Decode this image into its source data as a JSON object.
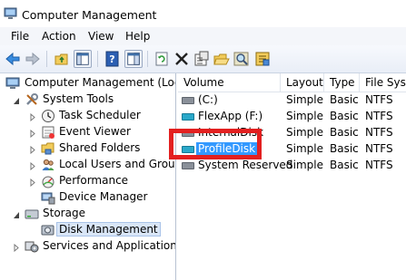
{
  "window": {
    "title": "Computer Management"
  },
  "menu": [
    "File",
    "Action",
    "View",
    "Help"
  ],
  "toolbar": {
    "buttons": [
      "back-icon",
      "forward-icon",
      "up-folder-icon",
      "show-hide-tree-icon",
      "help-icon",
      "properties-pane-icon",
      "refresh-icon",
      "delete-icon",
      "properties-icon",
      "open-icon",
      "search-icon",
      "settings-icon"
    ]
  },
  "tree": {
    "root": "Computer Management (Local",
    "items": [
      {
        "label": "System Tools",
        "icon": "tools-icon"
      },
      {
        "label": "Task Scheduler",
        "icon": "clock-icon"
      },
      {
        "label": "Event Viewer",
        "icon": "event-viewer-icon"
      },
      {
        "label": "Shared Folders",
        "icon": "shared-folder-icon"
      },
      {
        "label": "Local Users and Groups",
        "icon": "users-icon"
      },
      {
        "label": "Performance",
        "icon": "performance-icon"
      },
      {
        "label": "Device Manager",
        "icon": "device-manager-icon"
      },
      {
        "label": "Storage",
        "icon": "storage-icon"
      },
      {
        "label": "Disk Management",
        "icon": "disk-icon"
      },
      {
        "label": "Services and Applications",
        "icon": "services-icon"
      }
    ]
  },
  "list": {
    "columns": [
      "Volume",
      "Layout",
      "Type",
      "File Syste"
    ],
    "rows": [
      {
        "volume": "(C:)",
        "layout": "Simple",
        "type": "Basic",
        "fs": "NTFS",
        "icon_color": "#8a9099"
      },
      {
        "volume": "FlexApp (F:)",
        "layout": "Simple",
        "type": "Basic",
        "fs": "NTFS",
        "icon_color": "#2aa8c9"
      },
      {
        "volume": "InternalDisk",
        "layout": "Simple",
        "type": "Basic",
        "fs": "NTFS",
        "icon_color": "#8a9099"
      },
      {
        "volume": "ProfileDisk",
        "layout": "Simple",
        "type": "Basic",
        "fs": "NTFS",
        "icon_color": "#2aa8c9"
      },
      {
        "volume": "System Reserved",
        "layout": "Simple",
        "type": "Basic",
        "fs": "NTFS",
        "icon_color": "#8a9099"
      }
    ]
  },
  "annotation": {
    "color": "#e32020"
  }
}
